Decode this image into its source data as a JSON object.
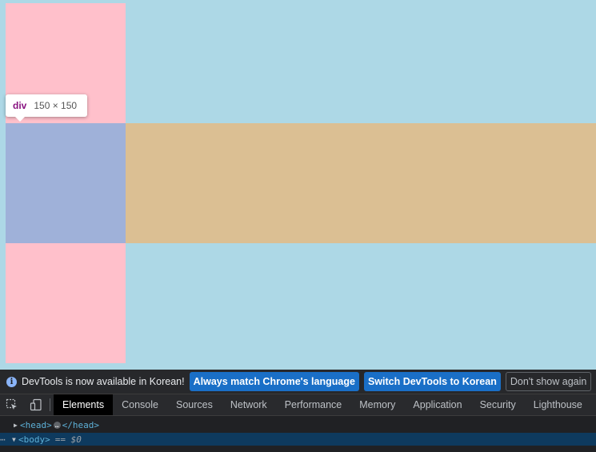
{
  "tooltip": {
    "tag": "div",
    "size": "150 × 150"
  },
  "infobar": {
    "message": "DevTools is now available in Korean!",
    "buttons": [
      "Always match Chrome's language",
      "Switch DevTools to Korean",
      "Don't show again"
    ]
  },
  "tabs": [
    "Elements",
    "Console",
    "Sources",
    "Network",
    "Performance",
    "Memory",
    "Application",
    "Security",
    "Lighthouse"
  ],
  "active_tab": "Elements",
  "dom_tree": {
    "head_open": "<head>",
    "head_close": "</head>",
    "body_open": "<body>",
    "body_marker": "== $0",
    "ellipsis": "…"
  },
  "colors": {
    "page_bg": "#add8e6",
    "pink": "#ffc0cb",
    "tan": "#dbbf93",
    "highlight": "#9fb1d9",
    "devtools_bg": "#202124",
    "button_blue": "#1a6fc7"
  }
}
